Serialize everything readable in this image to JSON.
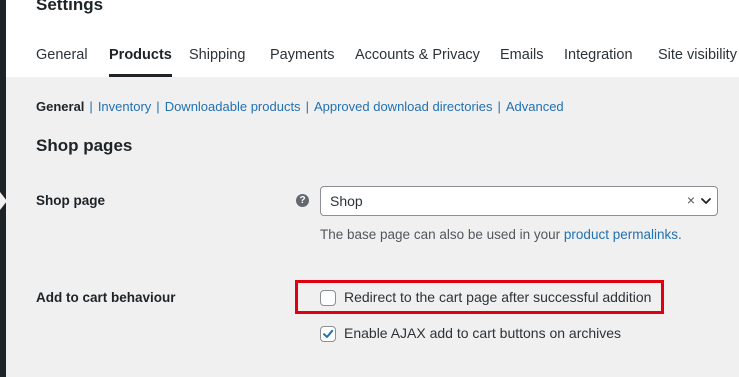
{
  "page": {
    "title": "Settings"
  },
  "tabs": [
    {
      "label": "General"
    },
    {
      "label": "Products",
      "active": true
    },
    {
      "label": "Shipping"
    },
    {
      "label": "Payments"
    },
    {
      "label": "Accounts & Privacy"
    },
    {
      "label": "Emails"
    },
    {
      "label": "Integration"
    },
    {
      "label": "Site visibility"
    }
  ],
  "subnav": {
    "current": "General",
    "separator": "|",
    "links": [
      "Inventory",
      "Downloadable products",
      "Approved download directories",
      "Advanced"
    ]
  },
  "section": {
    "title": "Shop pages"
  },
  "shop_page": {
    "label": "Shop page",
    "help_icon": "?",
    "selected": "Shop",
    "clear_symbol": "×",
    "description_prefix": "The base page can also be used in your ",
    "description_link": "product permalinks",
    "description_suffix": "."
  },
  "add_to_cart": {
    "label": "Add to cart behaviour",
    "options": [
      {
        "label": "Redirect to the cart page after successful addition",
        "checked": false
      },
      {
        "label": "Enable AJAX add to cart buttons on archives",
        "checked": true
      }
    ]
  },
  "colors": {
    "link": "#2271b1",
    "highlight": "#e0000f",
    "background": "#f0f0f1",
    "header": "#ffffff"
  }
}
